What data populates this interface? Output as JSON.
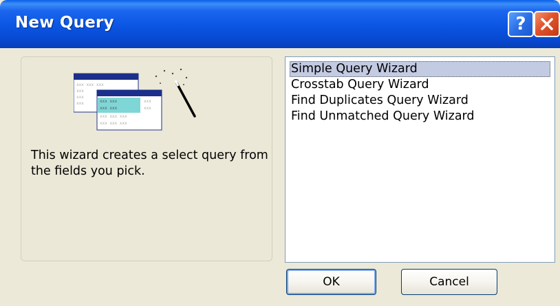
{
  "window": {
    "title": "New Query",
    "help_glyph": "?",
    "close_icon": "close-icon",
    "help_icon": "help-icon"
  },
  "info": {
    "description": "This wizard creates a select query from the fields you pick.",
    "illustration": "query-wizard-illustration"
  },
  "wizards": {
    "items": [
      {
        "label": "Simple Query Wizard",
        "selected": true
      },
      {
        "label": "Crosstab Query Wizard",
        "selected": false
      },
      {
        "label": "Find Duplicates Query Wizard",
        "selected": false
      },
      {
        "label": "Find Unmatched Query Wizard",
        "selected": false
      }
    ]
  },
  "buttons": {
    "ok_label": "OK",
    "cancel_label": "Cancel"
  },
  "colors": {
    "titlebar": "#0a55e2",
    "dialog_bg": "#ece9d8",
    "selection": "#c3cbe3",
    "close_button": "#e0532c"
  }
}
